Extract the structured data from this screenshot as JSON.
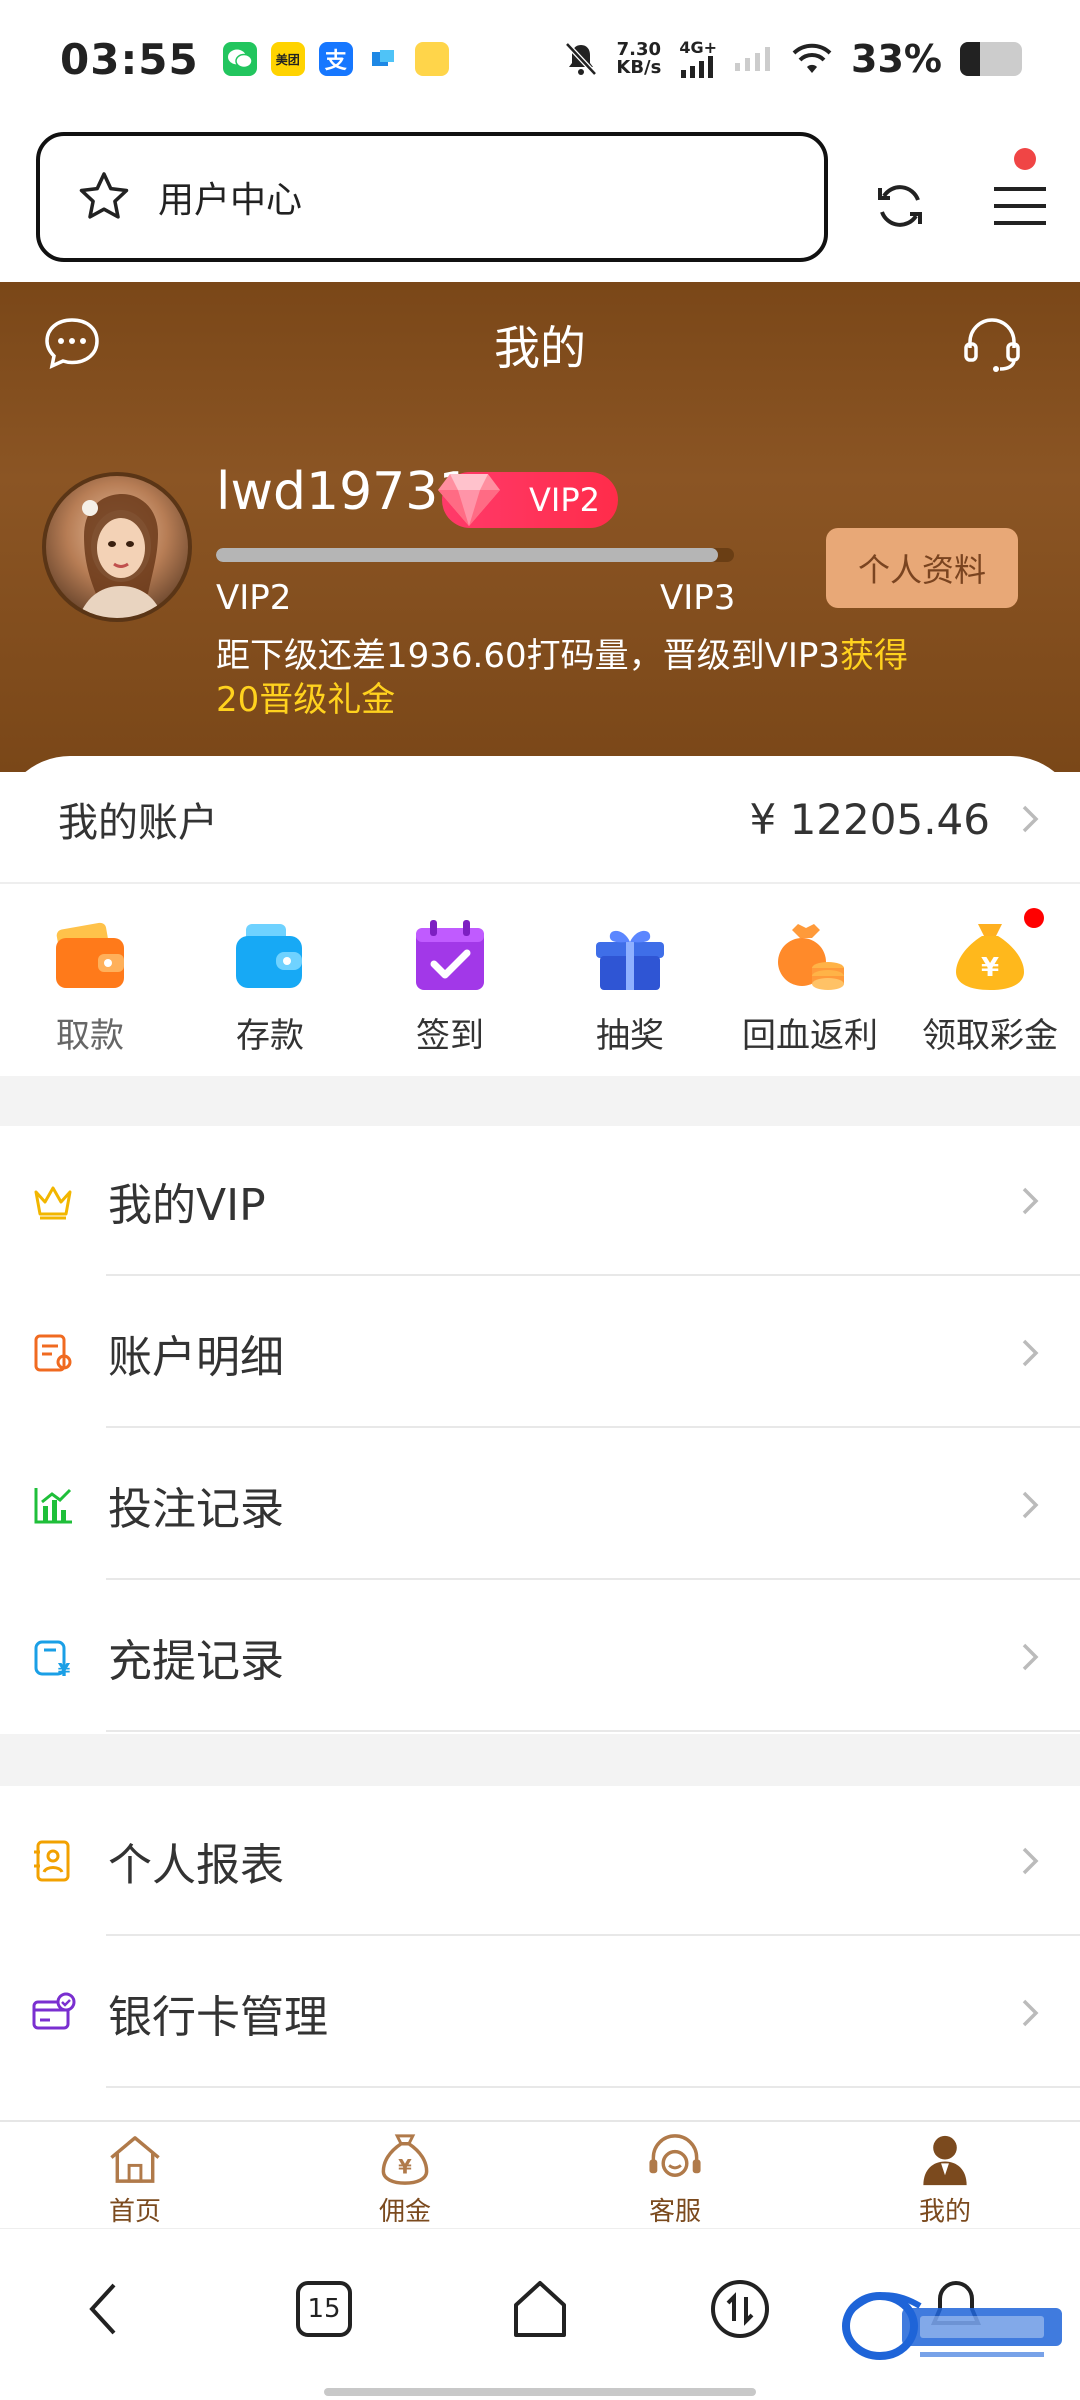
{
  "status_bar": {
    "time": "03:55",
    "net_speed_top": "7.30",
    "net_speed_bottom": "KB/s",
    "network": "4G+",
    "battery_text": "33%",
    "battery_level": 0.33,
    "app_icons": [
      "wechat-icon",
      "meituan-icon",
      "alipay-icon",
      "notification-app-icon",
      "notes-app-icon"
    ],
    "app_icon_labels": {
      "meituan": "美团",
      "alipay": "支"
    }
  },
  "browser": {
    "url_text": "用户中心"
  },
  "header": {
    "title": "我的",
    "username": "lwd19731",
    "vip_badge": "VIP2",
    "progress_fraction": 0.97,
    "level_current": "VIP2",
    "level_next": "VIP3",
    "profile_button": "个人资料",
    "hint_main": "距下级还差1936.60打码量，晋级到VIP3",
    "hint_highlight": "获得20晋级礼金"
  },
  "account": {
    "label": "我的账户",
    "balance": "¥ 12205.46"
  },
  "quick_actions": [
    {
      "label": "取款",
      "icon": "wallet-icon"
    },
    {
      "label": "存款",
      "icon": "deposit-wallet-icon"
    },
    {
      "label": "签到",
      "icon": "calendar-check-icon"
    },
    {
      "label": "抽奖",
      "icon": "gift-box-icon"
    },
    {
      "label": "回血返利",
      "icon": "coin-bag-icon"
    },
    {
      "label": "领取彩金",
      "icon": "money-bag-icon"
    }
  ],
  "menu_items": [
    {
      "label": "我的VIP",
      "icon": "crown-icon"
    },
    {
      "label": "账户明细",
      "icon": "account-detail-icon"
    },
    {
      "label": "投注记录",
      "icon": "bar-chart-icon"
    },
    {
      "label": "充提记录",
      "icon": "recharge-record-icon"
    },
    {
      "label": "个人报表",
      "icon": "personal-report-icon"
    },
    {
      "label": "银行卡管理",
      "icon": "bank-card-icon"
    }
  ],
  "tabs": [
    {
      "label": "首页",
      "icon": "home-icon"
    },
    {
      "label": "佣金",
      "icon": "commission-bag-icon"
    },
    {
      "label": "客服",
      "icon": "customer-service-icon"
    },
    {
      "label": "我的",
      "icon": "user-icon"
    }
  ],
  "nav": {
    "tabs_count": "15"
  },
  "colors": {
    "header_brown": "#7a4718",
    "accent_gold": "#ffd21e",
    "vip_red": "#ff2c4a",
    "profile_button_bg": "#e8a877",
    "tab_brown": "#7b4a1e"
  }
}
